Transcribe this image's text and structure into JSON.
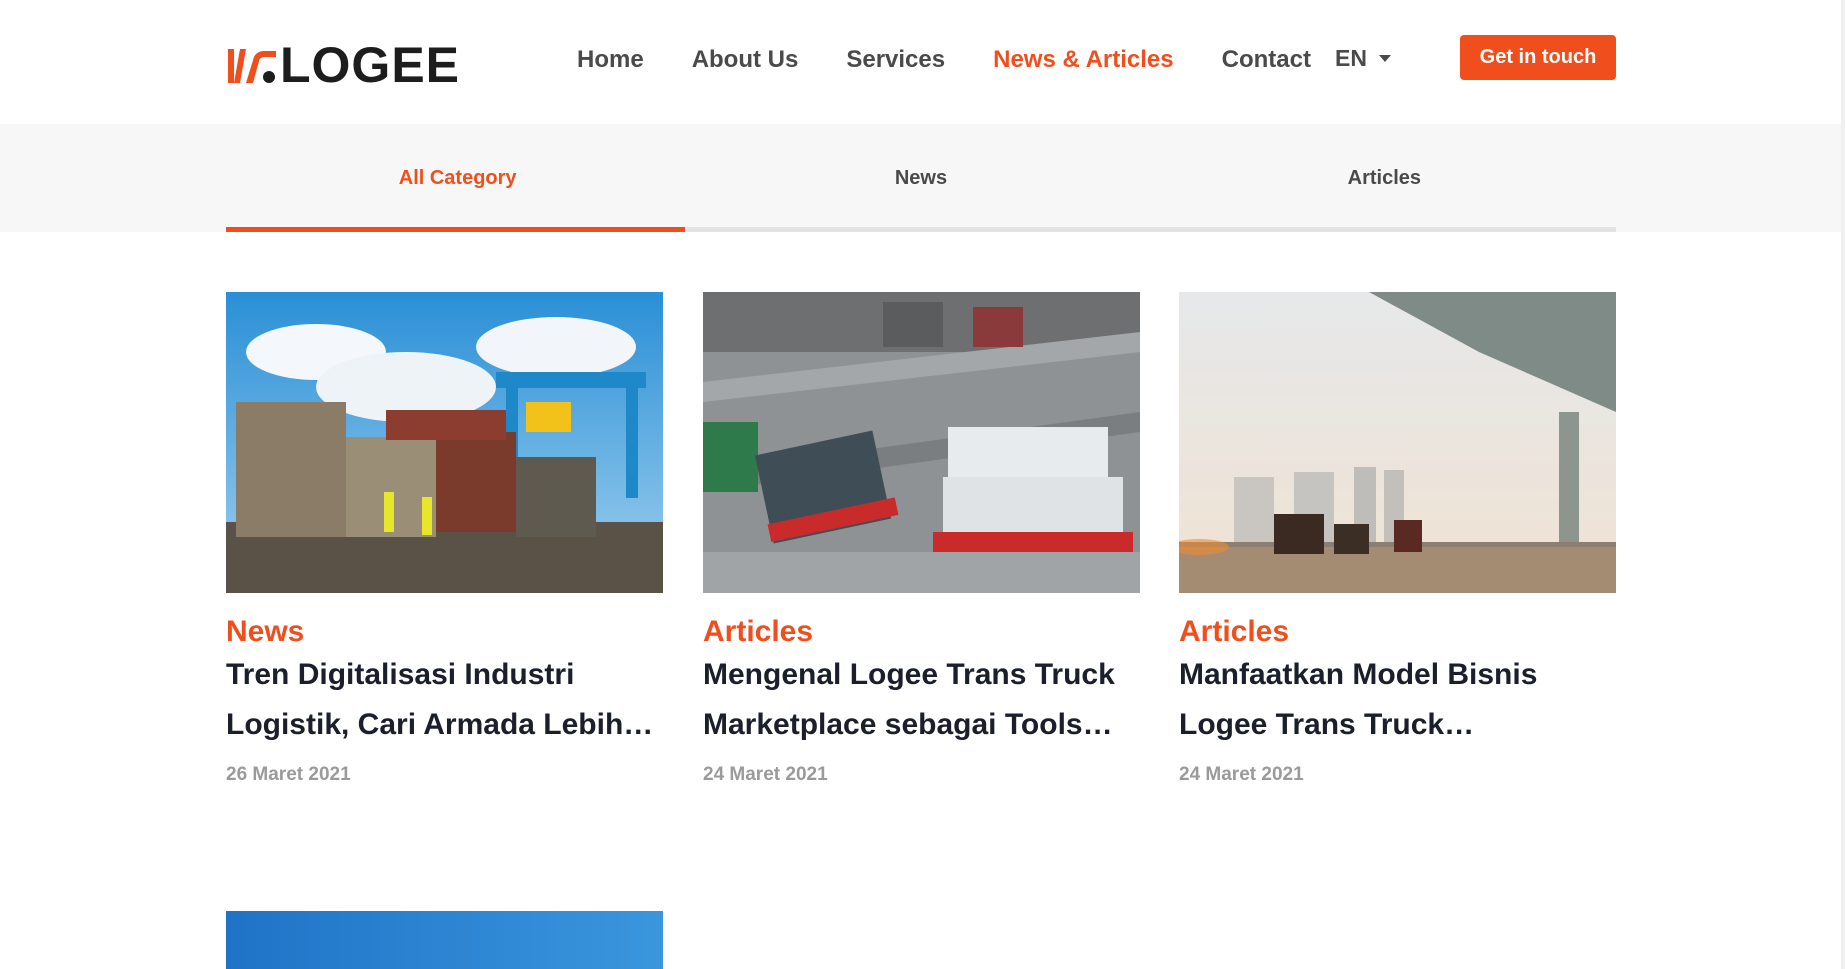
{
  "brand": {
    "name": "LOGEE",
    "accent": "#f04e1c"
  },
  "nav": {
    "items": [
      {
        "label": "Home",
        "active": false
      },
      {
        "label": "About Us",
        "active": false
      },
      {
        "label": "Services",
        "active": false
      },
      {
        "label": "News & Articles",
        "active": true
      },
      {
        "label": "Contact",
        "active": false
      }
    ],
    "language": "EN",
    "cta_label": "Get in touch"
  },
  "category_tabs": [
    {
      "label": "All Category",
      "active": true
    },
    {
      "label": "News",
      "active": false
    },
    {
      "label": "Articles",
      "active": false
    }
  ],
  "posts": [
    {
      "category": "News",
      "title": "Tren Digitalisasi Industri Logistik, Cari Armada Lebih Mudah",
      "date": "26 Maret 2021",
      "image": "container-yard-photo"
    },
    {
      "category": "Articles",
      "title": "Mengenal Logee Trans Truck Marketplace sebagai Tools Logistik",
      "date": "24 Maret 2021",
      "image": "port-trucks-aerial-photo"
    },
    {
      "category": "Articles",
      "title": "Manfaatkan Model Bisnis Logee Trans Truck Marketplace",
      "date": "24 Maret 2021",
      "image": "highway-trucks-photo"
    }
  ]
}
